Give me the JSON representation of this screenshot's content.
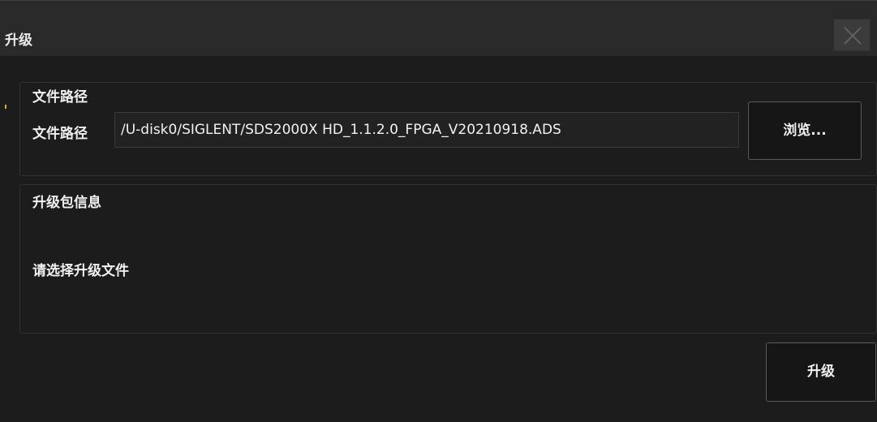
{
  "dialog": {
    "title": "升级",
    "close_icon": "close-icon"
  },
  "file_section": {
    "heading": "文件路径",
    "path_label": "文件路径",
    "path_value": "/U-disk0/SIGLENT/SDS2000X HD_1.1.2.0_FPGA_V20210918.ADS",
    "browse_label": "浏览..."
  },
  "info_section": {
    "heading": "升级包信息",
    "message": "请选择升级文件"
  },
  "actions": {
    "upgrade_label": "升级"
  },
  "colors": {
    "background": "#1c1c1c",
    "titlebar": "#2a2a2a",
    "text": "#f0f0f0",
    "border": "#5a5a5a"
  }
}
